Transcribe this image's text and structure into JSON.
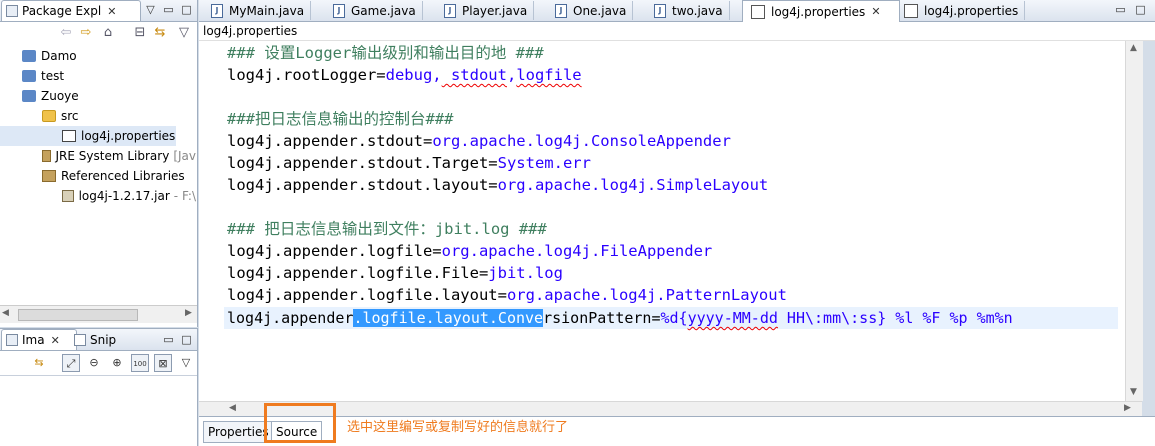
{
  "package_explorer": {
    "tab_label": "Package Expl",
    "tree": [
      {
        "label": "Damo",
        "icon": "project-icon",
        "indent": 0
      },
      {
        "label": "test",
        "icon": "project-icon",
        "indent": 0
      },
      {
        "label": "Zuoye",
        "icon": "project-icon",
        "indent": 0
      },
      {
        "label": "src",
        "icon": "package-folder-icon",
        "indent": 1
      },
      {
        "label": "log4j.properties",
        "icon": "properties-file-icon",
        "indent": 2
      },
      {
        "label": "JRE System Library",
        "suffix": "[Jav",
        "icon": "library-icon",
        "indent": 1
      },
      {
        "label": "Referenced Libraries",
        "icon": "library-icon",
        "indent": 1
      },
      {
        "label": "log4j-1.2.17.jar",
        "suffix": "- F:\\",
        "icon": "jar-icon",
        "indent": 2
      }
    ]
  },
  "lower_panel": {
    "tabs": [
      {
        "label": "Ima"
      },
      {
        "label": "Snip"
      }
    ]
  },
  "editor": {
    "tabs": [
      {
        "label": "MyMain.java",
        "type": "java"
      },
      {
        "label": "Game.java",
        "type": "java"
      },
      {
        "label": "Player.java",
        "type": "java"
      },
      {
        "label": "One.java",
        "type": "java"
      },
      {
        "label": "two.java",
        "type": "java"
      },
      {
        "label": "log4j.properties",
        "type": "properties",
        "active": true
      },
      {
        "label": "log4j.properties",
        "type": "properties"
      }
    ],
    "breadcrumb": "log4j.properties",
    "lines": {
      "l1": "### 设置Logger输出级别和输出目的地 ###",
      "l2_key": "log4j.rootLogger=",
      "l2_val_a": "debug,",
      "l2_val_b": " stdout",
      "l2_val_c": ",",
      "l2_val_d": "logfile",
      "l4": "###把日志信息输出的控制台###",
      "l5_key": "log4j.appender.stdout=",
      "l5_val": "org.apache.log4j.ConsoleAppender",
      "l6_key": "log4j.appender.stdout.Target=",
      "l6_val": "System.err",
      "l7_key": "log4j.appender.stdout.layout=",
      "l7_val": "org.apache.log4j.SimpleLayout",
      "l9": "### 把日志信息输出到文件：jbit.log ###",
      "l10_key": "log4j.appender.logfile=",
      "l10_val": "org.apache.log4j.FileAppender",
      "l11_key": "log4j.appender.logfile.File=",
      "l11_val": "jbit.log",
      "l12_key": "log4j.appender.logfile.layout=",
      "l12_val": "org.apache.log4j.PatternLayout",
      "l13_pre": "log4j.appender",
      "l13_sel": ".logfile.layout.Conve",
      "l13_post": "rsionPattern=",
      "l13_val_a": "%d{",
      "l13_val_b": "yyyy-MM-dd",
      "l13_val_c": " HH\\:mm\\:ss} %l %F %p %m%n"
    }
  },
  "bottom_tabs": [
    {
      "label": "Properties"
    },
    {
      "label": "Source",
      "active": true
    }
  ],
  "annotation": "选中这里编写或复制写好的信息就行了",
  "colors": {
    "annotation": "#ef7b1f",
    "selection": "#3399ff",
    "value": "#2a00ff",
    "comment": "#3f7f5f"
  }
}
